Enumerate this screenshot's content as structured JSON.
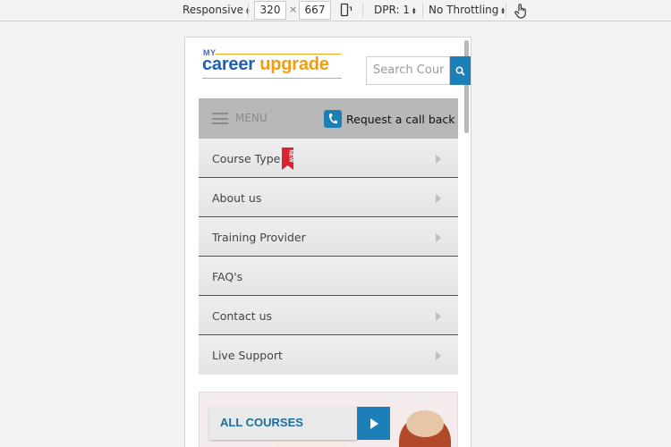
{
  "devtools": {
    "device": "Responsive",
    "width": "320",
    "times": "×",
    "height": "667",
    "dpr": "DPR: 1",
    "throttling": "No Throttling"
  },
  "header": {
    "logo_my": "MY",
    "logo_career": "career",
    "logo_upgrade": "upgrade",
    "search_placeholder": "Search Cour"
  },
  "menubar": {
    "menu_label": "MENU",
    "callback_label": "Request a call back"
  },
  "menu": {
    "items": [
      {
        "label": "Course Type",
        "badge": "NEW",
        "arrow": true
      },
      {
        "label": "About us",
        "arrow": true
      },
      {
        "label": "Training Provider",
        "arrow": true
      },
      {
        "label": "FAQ's",
        "arrow": false
      },
      {
        "label": "Contact us",
        "arrow": true
      },
      {
        "label": "Live Support",
        "arrow": true
      }
    ]
  },
  "banner": {
    "all_courses_label": "ALL COURSES"
  },
  "colors": {
    "accent": "#1c7fb8",
    "brand_blue": "#1f5fb4",
    "brand_orange": "#f29c11",
    "badge_red": "#d9232e"
  },
  "icons": [
    "rotate-device-icon",
    "touch-hand-icon",
    "search-icon",
    "hamburger-icon",
    "phone-icon",
    "new-ribbon-icon",
    "chevron-right-icon",
    "play-icon"
  ]
}
